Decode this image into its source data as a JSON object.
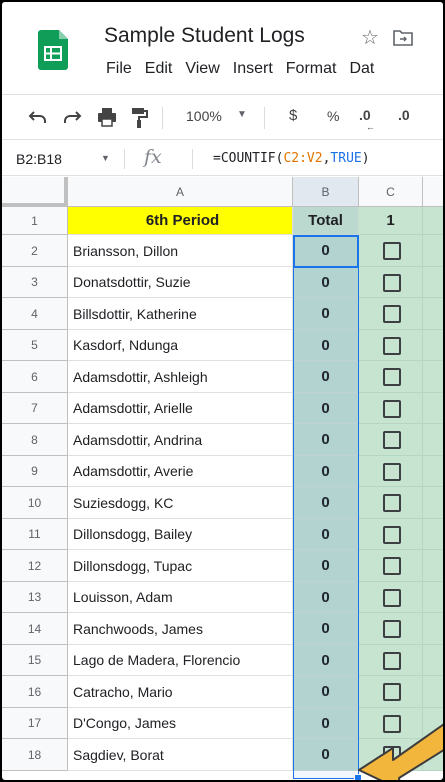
{
  "app": {
    "title": "Sample Student Logs",
    "menu": [
      "File",
      "Edit",
      "View",
      "Insert",
      "Format",
      "Dat"
    ]
  },
  "toolbar": {
    "zoom": "100%",
    "currency": "$",
    "percent": "%",
    "decimal_decrease": ".0",
    "decimal_increase": ".0"
  },
  "formula_bar": {
    "name_box": "B2:B18",
    "fx": "fx",
    "formula_prefix": "=COUNTIF(",
    "formula_range": "C2:V2",
    "formula_sep": ",",
    "formula_value": "TRUE",
    "formula_suffix": ")"
  },
  "columns": [
    "A",
    "B",
    "C"
  ],
  "header_row": {
    "row_number": "1",
    "a": "6th Period",
    "b": "Total",
    "c": "1"
  },
  "rows": [
    {
      "num": "2",
      "name": "Briansson, Dillon",
      "total": "0"
    },
    {
      "num": "3",
      "name": "Donatsdottir, Suzie",
      "total": "0"
    },
    {
      "num": "4",
      "name": "Billsdottir, Katherine",
      "total": "0"
    },
    {
      "num": "5",
      "name": "Kasdorf, Ndunga",
      "total": "0"
    },
    {
      "num": "6",
      "name": "Adamsdottir, Ashleigh",
      "total": "0"
    },
    {
      "num": "7",
      "name": "Adamsdottir, Arielle",
      "total": "0"
    },
    {
      "num": "8",
      "name": "Adamsdottir, Andrina",
      "total": "0"
    },
    {
      "num": "9",
      "name": "Adamsdottir, Averie",
      "total": "0"
    },
    {
      "num": "10",
      "name": "Suziesdogg, KC",
      "total": "0"
    },
    {
      "num": "11",
      "name": "Dillonsdogg, Bailey",
      "total": "0"
    },
    {
      "num": "12",
      "name": "Dillonsdogg, Tupac",
      "total": "0"
    },
    {
      "num": "13",
      "name": "Louisson, Adam",
      "total": "0"
    },
    {
      "num": "14",
      "name": "Ranchwoods, James",
      "total": "0"
    },
    {
      "num": "15",
      "name": "Lago de Madera, Florencio",
      "total": "0"
    },
    {
      "num": "16",
      "name": "Catracho, Mario",
      "total": "0"
    },
    {
      "num": "17",
      "name": "D'Congo, James",
      "total": "0"
    },
    {
      "num": "18",
      "name": "Sagdiev, Borat",
      "total": "0"
    }
  ],
  "colors": {
    "header_highlight": "#ffff00",
    "selection": "#1a73e8",
    "total_column": "#bcd9cf",
    "checkbox_column": "#c6e4d0",
    "arrow": "#f2b63c"
  }
}
